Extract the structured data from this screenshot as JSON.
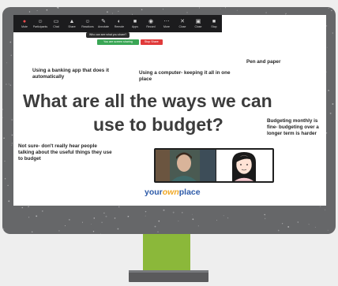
{
  "toolbar": {
    "items": [
      {
        "label": "Mute",
        "icon": "microphone-icon",
        "glyph": "●",
        "alert": true
      },
      {
        "label": "Participants",
        "icon": "participants-icon",
        "glyph": "☺",
        "alert": false
      },
      {
        "label": "Chat",
        "icon": "chat-icon",
        "glyph": "▭",
        "alert": false
      },
      {
        "label": "Share",
        "icon": "share-icon",
        "glyph": "▲",
        "alert": false
      },
      {
        "label": "Reactions",
        "icon": "reactions-icon",
        "glyph": "☺",
        "alert": false
      },
      {
        "label": "Annotate",
        "icon": "pen-icon",
        "glyph": "✎",
        "alert": false
      },
      {
        "label": "Remote",
        "icon": "remote-icon",
        "glyph": "◐",
        "alert": false
      },
      {
        "label": "Apps",
        "icon": "apps-icon",
        "glyph": "■",
        "alert": false
      },
      {
        "label": "Record",
        "icon": "record-icon",
        "glyph": "◉",
        "alert": false
      },
      {
        "label": "More",
        "icon": "more-icon",
        "glyph": "⋯",
        "alert": false
      },
      {
        "label": "Close",
        "icon": "close-icon",
        "glyph": "✕",
        "alert": false
      },
      {
        "label": "Close",
        "icon": "window-icon",
        "glyph": "▣",
        "alert": false
      },
      {
        "label": "Stop",
        "icon": "stop-icon",
        "glyph": "■",
        "alert": false
      }
    ]
  },
  "share": {
    "notice": "Who can see what you share?",
    "status": "You are screen sharing",
    "stop_label": "Stop Share",
    "status_color": "#3aa655",
    "stop_color": "#e03a3a"
  },
  "slide": {
    "notes": {
      "banking": "Using a banking app that does it automatically",
      "computer": "Using a computer- keeping it all in one place",
      "pen": "Pen and paper",
      "monthly": "Budgeting monthly is fine- budgeting over a longer term is harder",
      "not_sure": "Not sure- don't really hear people talking about the useful things they use to budget"
    },
    "headline_line1": "What are all the ways we can",
    "headline_line2": "use to budget?"
  },
  "brand": {
    "part1": "your",
    "part2": "own",
    "part3": "place",
    "primary_color": "#2d5aa8",
    "accent_color": "#f0a928"
  },
  "colors": {
    "monitor_frame": "#666769",
    "stand_neck": "#8bb83a",
    "stand_base": "#5a5a5c"
  }
}
